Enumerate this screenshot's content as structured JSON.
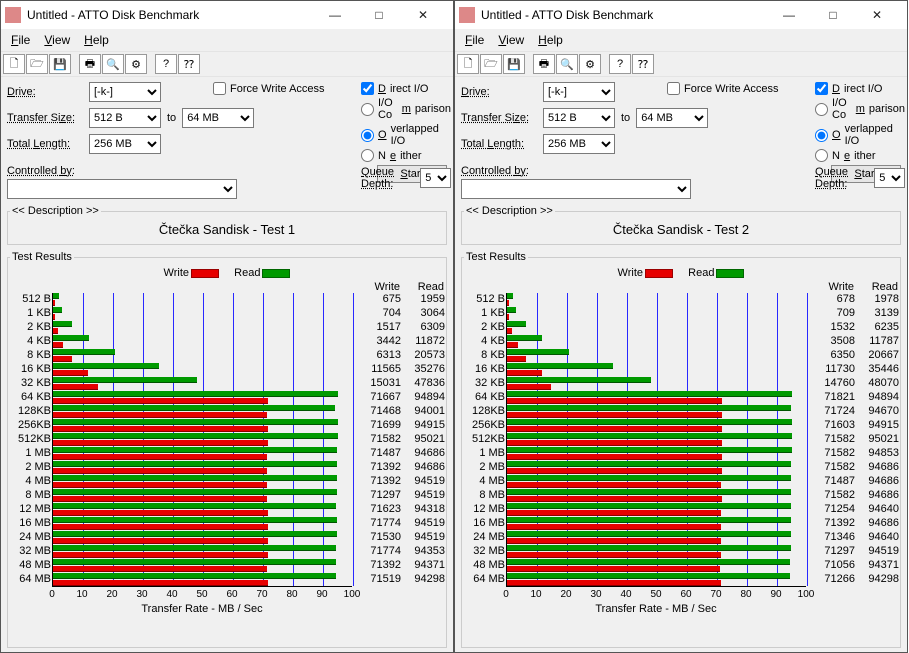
{
  "windows": [
    {
      "title": "Untitled - ATTO Disk Benchmark",
      "menu": [
        "File",
        "View",
        "Help"
      ],
      "drive": "[-k-]",
      "transfer_from": "512 B",
      "transfer_to_lbl": "to",
      "transfer_to": "64 MB",
      "total_length": "256 MB",
      "force_write": false,
      "direct_io": true,
      "radio_sel": "overlapped",
      "queue_depth": "5",
      "controlled_by": "",
      "start": "Start",
      "description_legend": "<< Description >>",
      "description": "Čtečka Sandisk - Test 1",
      "results_legend": "Test Results",
      "labels": {
        "drive": "Drive:",
        "tsize": "Transfer Size:",
        "tlen": "Total Length:",
        "fwa": "Force Write Access",
        "dio": "Direct I/O",
        "iocmp": "I/O Comparison",
        "ov": "Overlapped I/O",
        "ne": "Neither",
        "qd": "Queue Depth:",
        "ctrl": "Controlled by:",
        "write": "Write",
        "read": "Read",
        "xlabel": "Transfer Rate - MB / Sec"
      }
    },
    {
      "title": "Untitled - ATTO Disk Benchmark",
      "menu": [
        "File",
        "View",
        "Help"
      ],
      "drive": "[-k-]",
      "transfer_from": "512 B",
      "transfer_to_lbl": "to",
      "transfer_to": "64 MB",
      "total_length": "256 MB",
      "force_write": false,
      "direct_io": true,
      "radio_sel": "overlapped",
      "queue_depth": "5",
      "controlled_by": "",
      "start": "Start",
      "description_legend": "<< Description >>",
      "description": "Čtečka Sandisk - Test 2",
      "results_legend": "Test Results",
      "labels": {
        "drive": "Drive:",
        "tsize": "Transfer Size:",
        "tlen": "Total Length:",
        "fwa": "Force Write Access",
        "dio": "Direct I/O",
        "iocmp": "I/O Comparison",
        "ov": "Overlapped I/O",
        "ne": "Neither",
        "qd": "Queue Depth:",
        "ctrl": "Controlled by:",
        "write": "Write",
        "read": "Read",
        "xlabel": "Transfer Rate - MB / Sec"
      }
    }
  ],
  "chart_data": [
    {
      "type": "bar",
      "title": "Test Results",
      "xlabel": "Transfer Rate - MB / Sec",
      "xlim": [
        0,
        100
      ],
      "xticks": [
        0,
        10,
        20,
        30,
        40,
        50,
        60,
        70,
        80,
        90,
        100
      ],
      "categories": [
        "512 B",
        "1 KB",
        "2 KB",
        "4 KB",
        "8 KB",
        "16 KB",
        "32 KB",
        "64 KB",
        "128KB",
        "256KB",
        "512KB",
        "1 MB",
        "2 MB",
        "4 MB",
        "8 MB",
        "12 MB",
        "16 MB",
        "24 MB",
        "32 MB",
        "48 MB",
        "64 MB"
      ],
      "series": [
        {
          "name": "Write",
          "values": [
            675,
            704,
            1517,
            3442,
            6313,
            11565,
            15031,
            71667,
            71468,
            71699,
            71582,
            71487,
            71392,
            71392,
            71297,
            71623,
            71774,
            71530,
            71774,
            71392,
            71519
          ]
        },
        {
          "name": "Read",
          "values": [
            1959,
            3064,
            6309,
            11872,
            20573,
            35276,
            47836,
            94894,
            94001,
            94915,
            95021,
            94686,
            94686,
            94519,
            94519,
            94318,
            94519,
            94519,
            94353,
            94371,
            94298
          ]
        }
      ]
    },
    {
      "type": "bar",
      "title": "Test Results",
      "xlabel": "Transfer Rate - MB / Sec",
      "xlim": [
        0,
        100
      ],
      "xticks": [
        0,
        10,
        20,
        30,
        40,
        50,
        60,
        70,
        80,
        90,
        100
      ],
      "categories": [
        "512 B",
        "1 KB",
        "2 KB",
        "4 KB",
        "8 KB",
        "16 KB",
        "32 KB",
        "64 KB",
        "128KB",
        "256KB",
        "512KB",
        "1 MB",
        "2 MB",
        "4 MB",
        "8 MB",
        "12 MB",
        "16 MB",
        "24 MB",
        "32 MB",
        "48 MB",
        "64 MB"
      ],
      "series": [
        {
          "name": "Write",
          "values": [
            678,
            709,
            1532,
            3508,
            6350,
            11730,
            14760,
            71821,
            71724,
            71603,
            71582,
            71582,
            71582,
            71487,
            71582,
            71254,
            71392,
            71346,
            71297,
            71056,
            71266
          ]
        },
        {
          "name": "Read",
          "values": [
            1978,
            3139,
            6235,
            11787,
            20667,
            35446,
            48070,
            94894,
            94670,
            94915,
            95021,
            94853,
            94686,
            94686,
            94686,
            94640,
            94686,
            94640,
            94519,
            94371,
            94298
          ]
        }
      ]
    }
  ]
}
